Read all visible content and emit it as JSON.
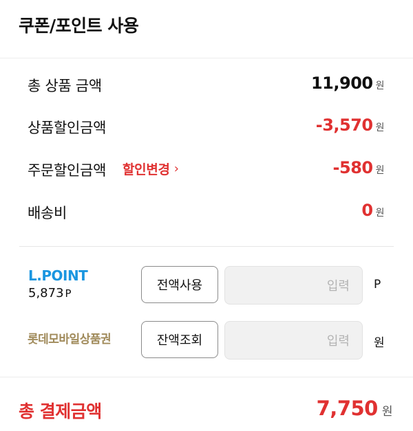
{
  "header": {
    "title": "쿠폰/포인트 사용"
  },
  "summary": {
    "product_total": {
      "label": "총 상품 금액",
      "amount": "11,900",
      "unit": "원"
    },
    "product_discount": {
      "label": "상품할인금액",
      "amount": "-3,570",
      "unit": "원"
    },
    "order_discount": {
      "label": "주문할인금액",
      "change_link": "할인변경",
      "amount": "-580",
      "unit": "원"
    },
    "shipping": {
      "label": "배송비",
      "amount": "0",
      "unit": "원"
    }
  },
  "lpoint": {
    "title": "L.POINT",
    "balance": "5,873",
    "balance_unit": "P",
    "button": "전액사용",
    "input_placeholder": "입력",
    "suffix": "P"
  },
  "giftcard": {
    "title": "롯데모바일상품권",
    "button": "잔액조회",
    "input_placeholder": "입력",
    "suffix": "원"
  },
  "total": {
    "label": "총 결제금액",
    "amount": "7,750",
    "unit": "원"
  },
  "colors": {
    "accent_red": "#e03131",
    "lpoint_blue": "#1a96e0",
    "giftcard_gold": "#a08a5a"
  }
}
